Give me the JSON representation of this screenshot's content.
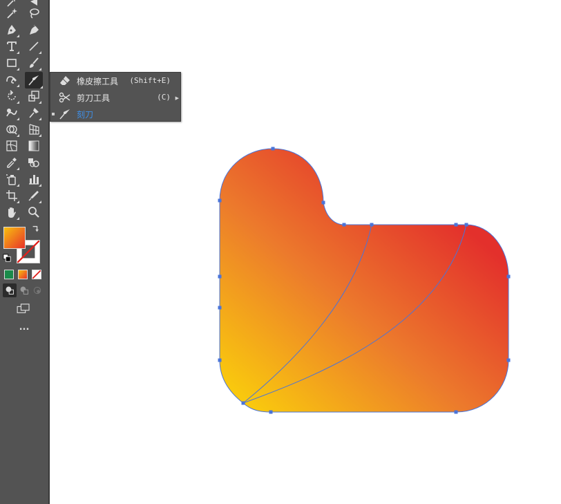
{
  "app": {
    "accent_color": "#3f8fe6",
    "toolbar_bg": "#535353"
  },
  "toolbar": {
    "tools": [
      {
        "name": "magic-wand-icon"
      },
      {
        "name": "lasso-icon"
      },
      {
        "name": "pen-icon"
      },
      {
        "name": "curvature-icon"
      },
      {
        "name": "type-icon"
      },
      {
        "name": "line-segment-icon"
      },
      {
        "name": "rectangle-icon"
      },
      {
        "name": "paintbrush-icon"
      },
      {
        "name": "shaper-icon"
      },
      {
        "name": "knife-icon",
        "active": true
      },
      {
        "name": "rotate-icon"
      },
      {
        "name": "scale-icon"
      },
      {
        "name": "warp-icon"
      },
      {
        "name": "puppet-warp-icon"
      },
      {
        "name": "shape-builder-icon"
      },
      {
        "name": "perspective-grid-icon"
      },
      {
        "name": "mesh-icon"
      },
      {
        "name": "gradient-icon"
      },
      {
        "name": "eyedropper-icon"
      },
      {
        "name": "blend-icon"
      },
      {
        "name": "symbol-sprayer-icon"
      },
      {
        "name": "column-graph-icon"
      },
      {
        "name": "artboard-icon"
      },
      {
        "name": "slice-icon"
      },
      {
        "name": "hand-icon"
      },
      {
        "name": "zoom-icon"
      }
    ],
    "fill_colors": [
      "#f7c00f",
      "#e8322a"
    ],
    "color_modes": [
      {
        "name": "color-mode-icon",
        "color": "#1a8a4a"
      },
      {
        "name": "gradient-mode-icon",
        "color": "#f0a020"
      },
      {
        "name": "none-mode-icon",
        "color": "#e0201c"
      }
    ],
    "more_label": "..."
  },
  "flyout": {
    "items": [
      {
        "icon": "eraser-icon",
        "label": "橡皮擦工具",
        "shortcut": "(Shift+E)"
      },
      {
        "icon": "scissors-icon",
        "label": "剪刀工具",
        "shortcut": "(C)"
      },
      {
        "icon": "knife-icon",
        "label": "刻刀",
        "shortcut": "",
        "selected": true
      }
    ]
  },
  "artwork": {
    "gradient_start": "#f9c80e",
    "gradient_mid": "#ec7a2c",
    "gradient_end": "#e3302c",
    "path_color": "#4a74d9"
  }
}
